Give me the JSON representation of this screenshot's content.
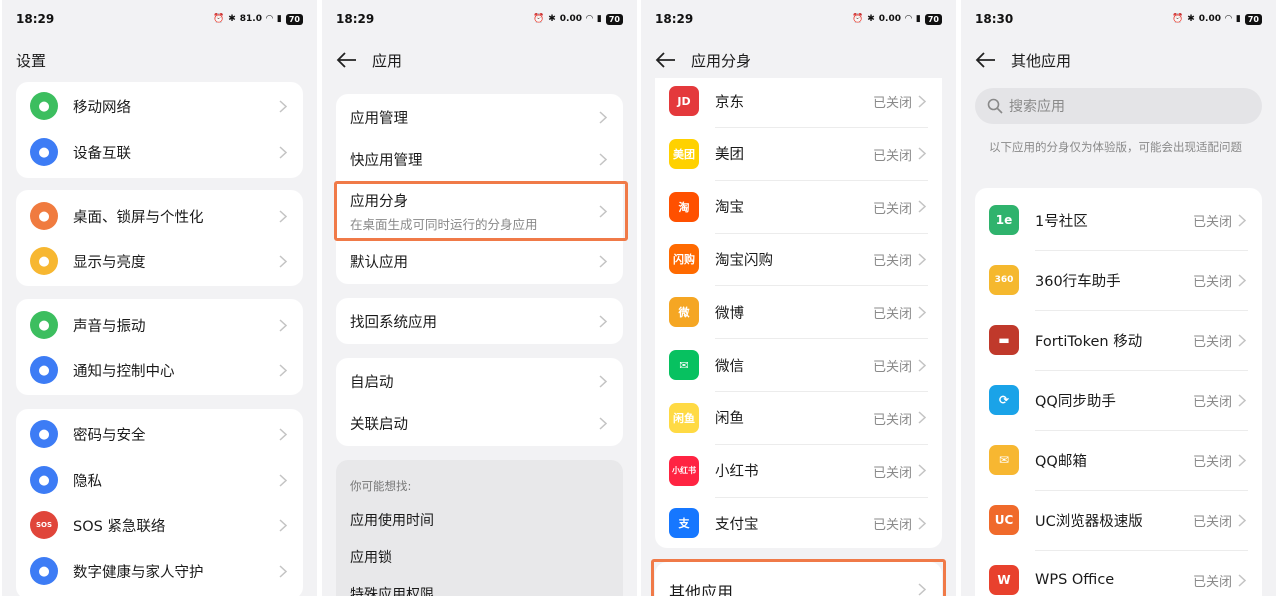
{
  "status_bar": {
    "s1_time": "18:29",
    "s2_time": "18:29",
    "s3_time": "18:29",
    "s4_time": "18:30",
    "s1_speed": "81.0",
    "other_speed": "0.00",
    "battery": "70"
  },
  "screen1": {
    "title": "设置",
    "items": [
      {
        "label": "移动网络",
        "color": "#3cbe5f",
        "icon": "signal-arrows-icon"
      },
      {
        "label": "设备互联",
        "color": "#3d7cf5",
        "icon": "device-link-icon"
      },
      {
        "label": "桌面、锁屏与个性化",
        "color": "#f07b3f",
        "icon": "palette-icon"
      },
      {
        "label": "显示与亮度",
        "color": "#f7b731",
        "icon": "sun-icon"
      },
      {
        "label": "声音与振动",
        "color": "#3cbe5f",
        "icon": "bell-icon"
      },
      {
        "label": "通知与控制中心",
        "color": "#3d7cf5",
        "icon": "notification-icon"
      },
      {
        "label": "密码与安全",
        "color": "#3d7cf5",
        "icon": "key-icon"
      },
      {
        "label": "隐私",
        "color": "#3d7cf5",
        "icon": "privacy-icon"
      },
      {
        "label": "SOS 紧急联络",
        "color": "#e0453a",
        "icon": "sos-icon",
        "icon_text": "SOS"
      },
      {
        "label": "数字健康与家人守护",
        "color": "#3d7cf5",
        "icon": "family-icon"
      }
    ]
  },
  "screen2": {
    "title": "应用",
    "items": [
      {
        "label": "应用管理"
      },
      {
        "label": "快应用管理"
      },
      {
        "label": "应用分身",
        "sub": "在桌面生成可同时运行的分身应用"
      },
      {
        "label": "默认应用"
      },
      {
        "label": "找回系统应用"
      },
      {
        "label": "自启动"
      },
      {
        "label": "关联启动"
      }
    ],
    "suggest_title": "你可能想找:",
    "suggest": [
      "应用使用时间",
      "应用锁",
      "特殊应用权限"
    ]
  },
  "screen3": {
    "title": "应用分身",
    "state": "已关闭",
    "apps": [
      {
        "label": "京东",
        "color": "#e4393c",
        "icon": "jd-icon",
        "icon_text": "JD"
      },
      {
        "label": "美团",
        "color": "#ffd100",
        "icon": "meituan-icon",
        "icon_text": "美团"
      },
      {
        "label": "淘宝",
        "color": "#ff5000",
        "icon": "taobao-icon",
        "icon_text": "淘"
      },
      {
        "label": "淘宝闪购",
        "color": "#ff6a00",
        "icon": "taobao-flash-icon",
        "icon_text": "闪购"
      },
      {
        "label": "微博",
        "color": "#f5a623",
        "icon": "weibo-icon",
        "icon_text": "微"
      },
      {
        "label": "微信",
        "color": "#07c160",
        "icon": "wechat-icon",
        "icon_text": "✉"
      },
      {
        "label": "闲鱼",
        "color": "#ffda44",
        "icon": "xianyu-icon",
        "icon_text": "闲鱼"
      },
      {
        "label": "小红书",
        "color": "#ff2442",
        "icon": "xiaohongshu-icon",
        "icon_text": "小红书"
      },
      {
        "label": "支付宝",
        "color": "#1677ff",
        "icon": "alipay-icon",
        "icon_text": "支"
      }
    ],
    "other": "其他应用"
  },
  "screen4": {
    "title": "其他应用",
    "search_placeholder": "搜索应用",
    "note": "以下应用的分身仅为体验版，可能会出现适配问题",
    "state": "已关闭",
    "apps": [
      {
        "label": "1号社区",
        "color": "#2fb36d",
        "icon": "community-icon",
        "icon_text": "1e"
      },
      {
        "label": "360行车助手",
        "color": "#f5b82e",
        "icon": "car-helper-icon",
        "icon_text": "360"
      },
      {
        "label": "FortiToken 移动",
        "color": "#c0392b",
        "icon": "fortitoken-icon",
        "icon_text": "▬"
      },
      {
        "label": "QQ同步助手",
        "color": "#1aa3e8",
        "icon": "qq-sync-icon",
        "icon_text": "⟳"
      },
      {
        "label": "QQ邮箱",
        "color": "#f7b731",
        "icon": "qq-mail-icon",
        "icon_text": "✉"
      },
      {
        "label": "UC浏览器极速版",
        "color": "#f06a2b",
        "icon": "uc-browser-icon",
        "icon_text": "UC"
      },
      {
        "label": "WPS Office",
        "color": "#e8412d",
        "icon": "wps-icon",
        "icon_text": "W"
      }
    ]
  }
}
